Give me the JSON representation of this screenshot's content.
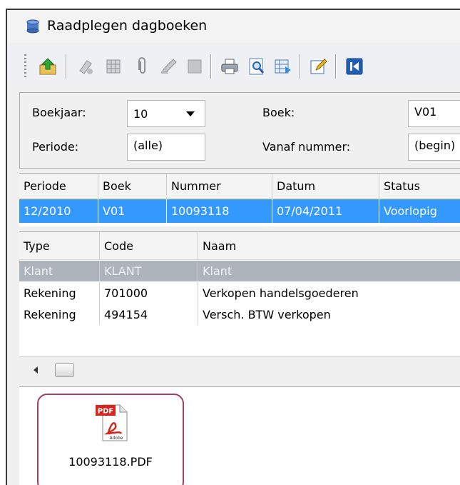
{
  "window": {
    "title": "Raadplegen dagboeken"
  },
  "icons": {
    "app": "database-icon",
    "toolbar": [
      "export-up-icon",
      "attach-clip-icon",
      "print-grid-icon",
      "paperclip-icon",
      "edit-pen-icon",
      "block-icon",
      "print-icon",
      "preview-icon",
      "export-grid-icon",
      "edit-form-icon",
      "first-record-icon"
    ]
  },
  "filters": {
    "boekjaar_label": "Boekjaar:",
    "boekjaar_value": "10",
    "periode_label": "Periode:",
    "periode_value": "(alle)",
    "boek_label": "Boek:",
    "boek_value": "V01",
    "vanaf_label": "Vanaf nummer:",
    "vanaf_value": "(begin)"
  },
  "journal_table": {
    "columns": [
      "Periode",
      "Boek",
      "Nummer",
      "Datum",
      "Status"
    ],
    "rows": [
      {
        "periode": "12/2010",
        "boek": "V01",
        "nummer": "10093118",
        "datum": "07/04/2011",
        "status": "Voorlopig"
      }
    ]
  },
  "lines_table": {
    "columns": [
      "Type",
      "Code",
      "Naam"
    ],
    "rows": [
      {
        "type": "Klant",
        "code": "KLANT",
        "naam": "Klant"
      },
      {
        "type": "Rekening",
        "code": "701000",
        "naam": "Verkopen handelsgoederen"
      },
      {
        "type": "Rekening",
        "code": "494154",
        "naam": "Versch. BTW verkopen"
      }
    ]
  },
  "attachment": {
    "icon": "pdf-file-icon",
    "badge": "PDF",
    "sublabel": "Adobe",
    "filename": "10093118.PDF"
  },
  "colors": {
    "selection": "#3399ff",
    "inactive_row": "#aeb4bc",
    "attachment_border": "#a2415e"
  }
}
